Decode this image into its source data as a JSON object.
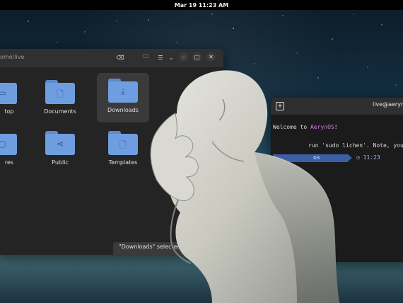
{
  "topbar": {
    "clock": "Mar 19  11:23 AM"
  },
  "files_window": {
    "path": "ome/live",
    "items": [
      {
        "label": "top",
        "icon": "desktop-folder-icon"
      },
      {
        "label": "Documents",
        "icon": "document-icon"
      },
      {
        "label": "Downloads",
        "icon": "download-icon",
        "selected": true
      },
      {
        "label": "res",
        "icon": "pictures-folder-icon"
      },
      {
        "label": "Public",
        "icon": "share-icon"
      },
      {
        "label": "Templates",
        "icon": "template-icon"
      }
    ],
    "status": "\"Downloads\" selected  (c"
  },
  "terminal": {
    "title": "live@aeryno",
    "welcome_prefix": "Welcome to ",
    "welcome_name": "AerynOS",
    "welcome_suffix": "!",
    "hint": "run 'sudo lichen'. Note, you nee",
    "prompt": "os",
    "clock": "◷ 11:23"
  },
  "colors": {
    "accent": "#6f9ee0",
    "terminal_accent": "#c97fd8"
  }
}
